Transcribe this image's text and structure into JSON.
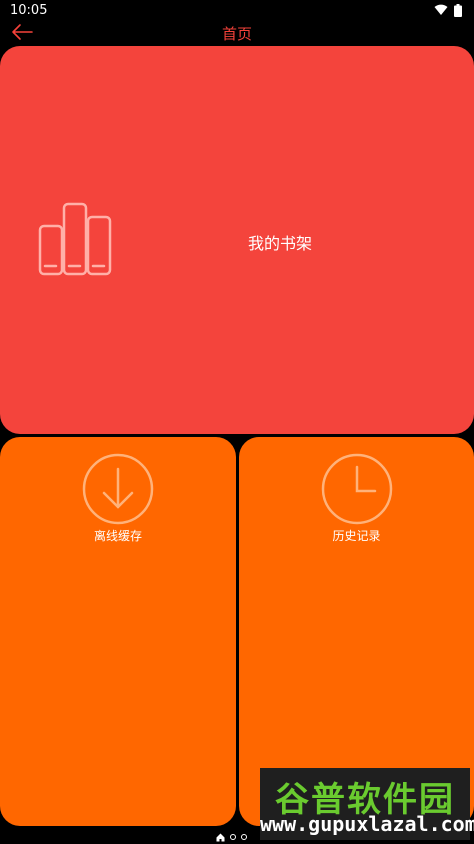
{
  "status_bar": {
    "time": "10:05"
  },
  "app_bar": {
    "title": "首页"
  },
  "tiles": {
    "shelf": {
      "label": "我的书架"
    },
    "offline": {
      "label": "离线缓存"
    },
    "history": {
      "label": "历史记录"
    }
  },
  "watermark": {
    "title": "谷普软件园",
    "url": "www.gupuxlazal.com"
  },
  "colors": {
    "title_red": "#f5423a",
    "shelf_bg": "#f4443c",
    "tile_orange": "#ff6700"
  }
}
